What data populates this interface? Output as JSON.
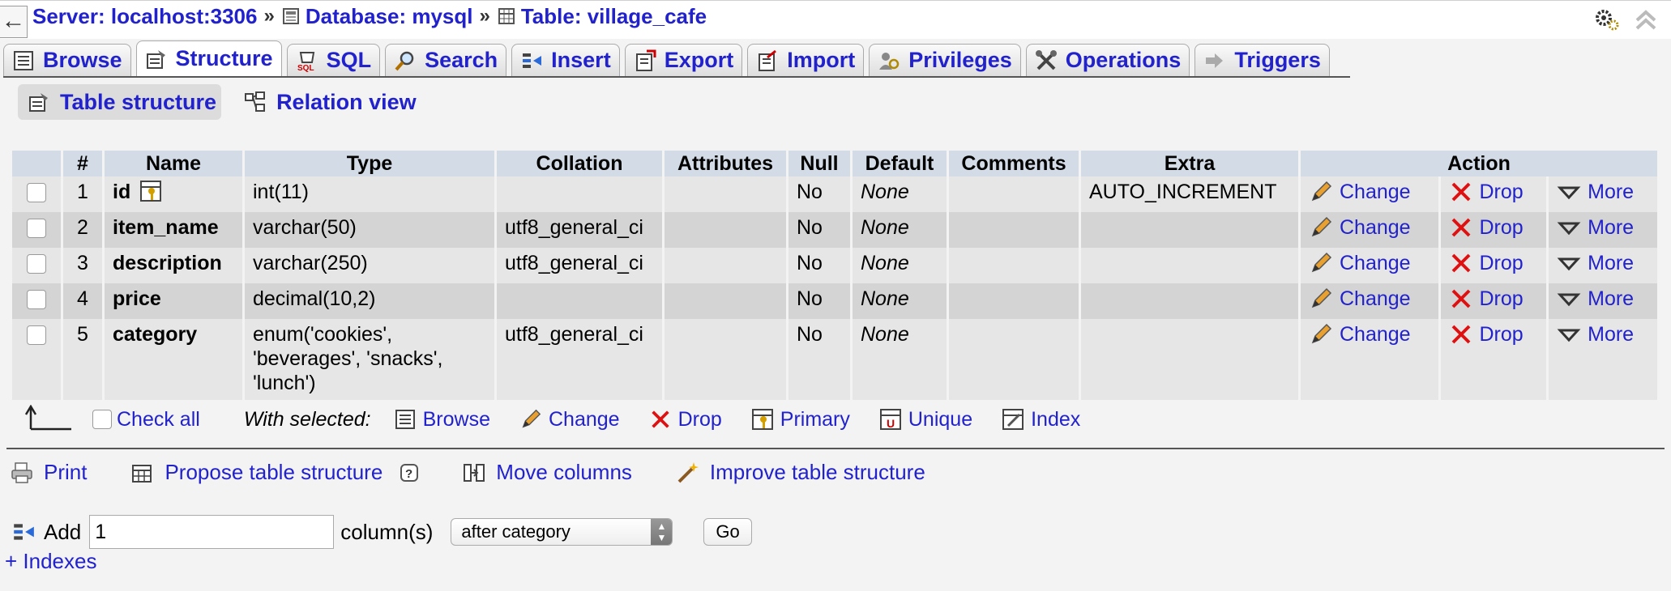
{
  "breadcrumb": {
    "server": "Server: localhost:3306",
    "database": "Database: mysql",
    "table": "Table: village_cafe",
    "sep": "»"
  },
  "nav": {
    "back": "←"
  },
  "tabs": [
    {
      "label": "Browse",
      "icon": "browse-icon"
    },
    {
      "label": "Structure",
      "icon": "structure-icon",
      "active": true
    },
    {
      "label": "SQL",
      "icon": "sql-icon"
    },
    {
      "label": "Search",
      "icon": "search-icon"
    },
    {
      "label": "Insert",
      "icon": "insert-icon"
    },
    {
      "label": "Export",
      "icon": "export-icon"
    },
    {
      "label": "Import",
      "icon": "import-icon"
    },
    {
      "label": "Privileges",
      "icon": "privileges-icon"
    },
    {
      "label": "Operations",
      "icon": "operations-icon"
    },
    {
      "label": "Triggers",
      "icon": "triggers-icon"
    }
  ],
  "subtabs": {
    "table_structure": "Table structure",
    "relation_view": "Relation view"
  },
  "columns": {
    "num": "#",
    "name": "Name",
    "type": "Type",
    "collation": "Collation",
    "attributes": "Attributes",
    "null": "Null",
    "default": "Default",
    "comments": "Comments",
    "extra": "Extra",
    "action": "Action"
  },
  "actions": {
    "change": "Change",
    "drop": "Drop",
    "more": "More"
  },
  "rows": [
    {
      "num": "1",
      "name": "id",
      "type": "int(11)",
      "collation": "",
      "attributes": "",
      "null": "No",
      "default": "None",
      "comments": "",
      "extra": "AUTO_INCREMENT"
    },
    {
      "num": "2",
      "name": "item_name",
      "type": "varchar(50)",
      "collation": "utf8_general_ci",
      "attributes": "",
      "null": "No",
      "default": "None",
      "comments": "",
      "extra": ""
    },
    {
      "num": "3",
      "name": "description",
      "type": "varchar(250)",
      "collation": "utf8_general_ci",
      "attributes": "",
      "null": "No",
      "default": "None",
      "comments": "",
      "extra": ""
    },
    {
      "num": "4",
      "name": "price",
      "type": "decimal(10,2)",
      "collation": "",
      "attributes": "",
      "null": "No",
      "default": "None",
      "comments": "",
      "extra": ""
    },
    {
      "num": "5",
      "name": "category",
      "type": "enum('cookies', 'beverages', 'snacks', 'lunch')",
      "collation": "utf8_general_ci",
      "attributes": "",
      "null": "No",
      "default": "None",
      "comments": "",
      "extra": ""
    }
  ],
  "with_selected": {
    "check_all": "Check all",
    "label": "With selected:",
    "browse": "Browse",
    "change": "Change",
    "drop": "Drop",
    "primary": "Primary",
    "unique": "Unique",
    "index": "Index"
  },
  "bottom": {
    "print": "Print",
    "propose": "Propose table structure",
    "move_columns": "Move columns",
    "improve": "Improve table structure"
  },
  "add": {
    "label": "Add",
    "count": "1",
    "columns_label": "column(s)",
    "position": "after category",
    "go": "Go"
  },
  "indexes_link": "+ Indexes",
  "colors": {
    "link": "#2222cc",
    "header_bg": "#d3dce6",
    "row_odd": "#e6e6e6",
    "row_even": "#d4d4d4"
  }
}
